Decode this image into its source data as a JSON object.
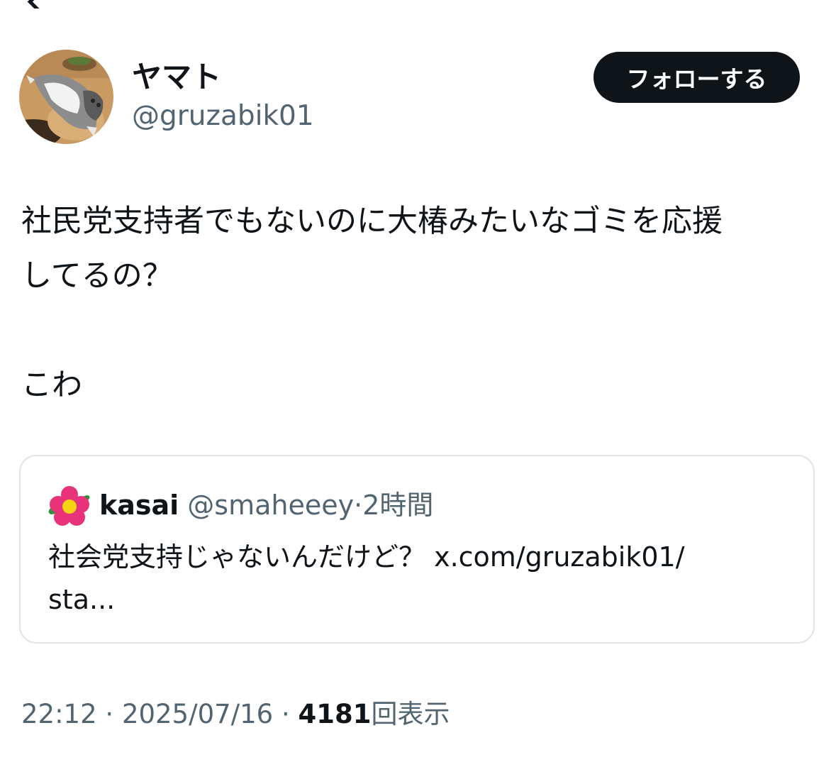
{
  "author": {
    "display_name": "ヤマト",
    "handle": "@gruzabik01"
  },
  "follow_button_label": "フォローする",
  "tweet": {
    "text": "社民党支持者でもないのに大椿みたいなゴミを応援\nしてるの？\n\nこわ"
  },
  "quote": {
    "name": "kasai",
    "handle": "@smaheeey",
    "separator": "·",
    "time": "2時間",
    "text": "社会党支持じゃないんだけど？ x.com/gruzabik01/\nsta..."
  },
  "meta": {
    "time": "22:12",
    "sep1": "·",
    "date": "2025/07/16",
    "sep2": "·",
    "views_count": "4181",
    "views_label": "回表示"
  },
  "colors": {
    "text_primary": "#0f1419",
    "text_secondary": "#536471",
    "border": "#dfe4e8",
    "follow_button_bg": "#0f1419"
  },
  "icons": {
    "author_avatar": "cat-photo-avatar",
    "quote_avatar": "camellia-flower-icon"
  }
}
